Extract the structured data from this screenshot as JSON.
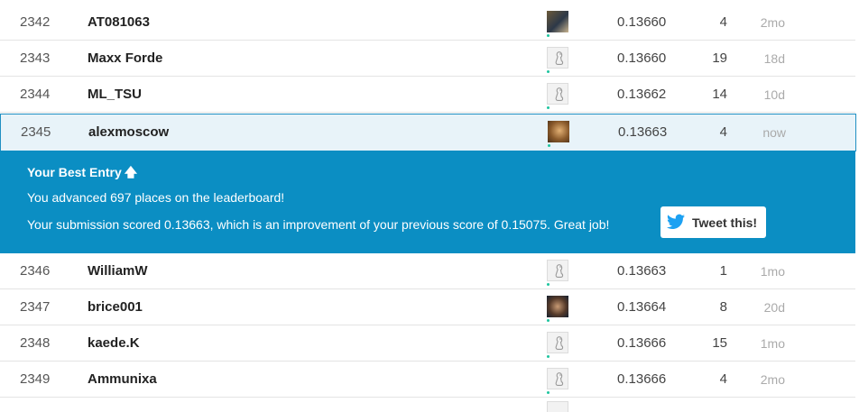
{
  "rows_top": [
    {
      "rank": "2342",
      "team": "AT081063",
      "avatar": "photo1",
      "score": "0.13660",
      "entries": "4",
      "last": "2mo"
    },
    {
      "rank": "2343",
      "team": "Maxx Forde",
      "avatar": "goose",
      "score": "0.13660",
      "entries": "19",
      "last": "18d"
    },
    {
      "rank": "2344",
      "team": "ML_TSU",
      "avatar": "goose",
      "score": "0.13662",
      "entries": "14",
      "last": "10d"
    }
  ],
  "current": {
    "rank": "2345",
    "team": "alexmoscow",
    "avatar": "photo2",
    "score": "0.13663",
    "entries": "4",
    "last": "now"
  },
  "banner": {
    "title": "Your Best Entry",
    "arrow_icon": "arrow-up-icon",
    "line1": "You advanced 697 places on the leaderboard!",
    "line2": "Your submission scored 0.13663, which is an improvement of your previous score of 0.15075. Great job!",
    "tweet_label": "Tweet this!",
    "tweet_icon": "twitter-bird-icon",
    "color": "#0b8ec3"
  },
  "rows_bottom": [
    {
      "rank": "2346",
      "team": "WilliamW",
      "avatar": "goose",
      "score": "0.13663",
      "entries": "1",
      "last": "1mo"
    },
    {
      "rank": "2347",
      "team": "brice001",
      "avatar": "photo3",
      "score": "0.13664",
      "entries": "8",
      "last": "20d"
    },
    {
      "rank": "2348",
      "team": "kaede.K",
      "avatar": "goose",
      "score": "0.13666",
      "entries": "15",
      "last": "1mo"
    },
    {
      "rank": "2349",
      "team": "Ammunixa",
      "avatar": "goose",
      "score": "0.13666",
      "entries": "4",
      "last": "2mo"
    }
  ]
}
